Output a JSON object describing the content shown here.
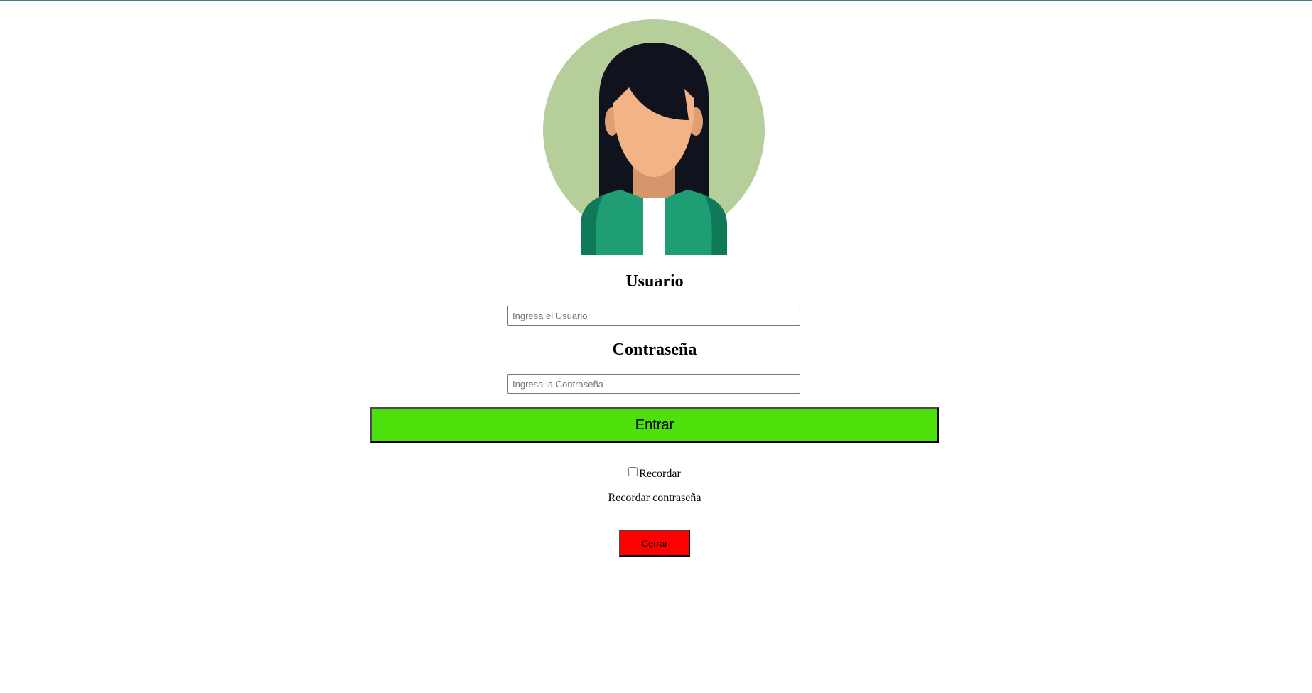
{
  "login": {
    "user_label": "Usuario",
    "user_placeholder": "Ingresa el Usuario",
    "user_value": "",
    "password_label": "Contraseña",
    "password_placeholder": "Ingresa la Contraseña",
    "password_value": "",
    "enter_label": "Entrar",
    "remember_label": "Recordar",
    "remember_checked": false,
    "forgot_label": "Recordar contraseña",
    "close_label": "Cerrar"
  },
  "avatar": {
    "icon": "woman-avatar-icon"
  },
  "colors": {
    "enter_button": "#4ee00a",
    "close_button": "#ff0000",
    "avatar_circle": "#b5ce9a",
    "avatar_hair": "#10131e",
    "avatar_skin": "#f2b486",
    "avatar_jacket": "#1e9e72",
    "top_border": "#3f7f86"
  }
}
